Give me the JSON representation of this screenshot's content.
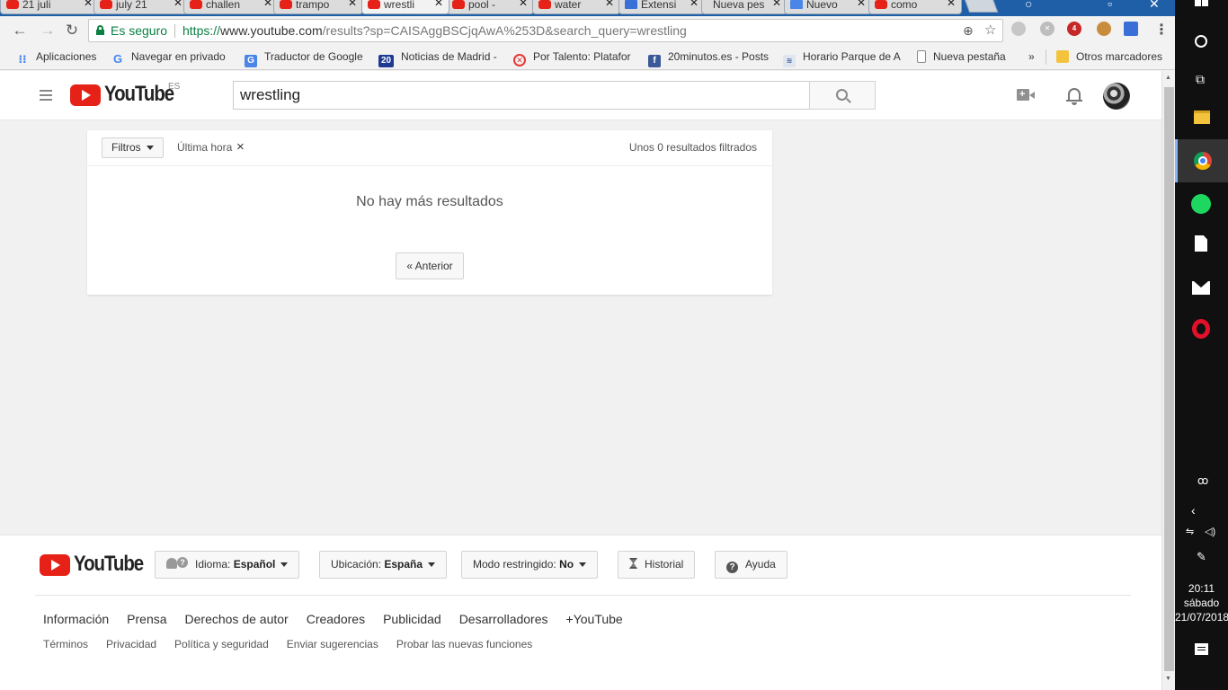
{
  "browser": {
    "tabs": [
      {
        "label": "21 juli",
        "favicon": "youtube-icon",
        "active": false
      },
      {
        "label": "july 21",
        "favicon": "youtube-icon",
        "active": false
      },
      {
        "label": "challen",
        "favicon": "youtube-icon",
        "active": false
      },
      {
        "label": "trampo",
        "favicon": "youtube-icon",
        "active": false
      },
      {
        "label": "wrestli",
        "favicon": "youtube-icon",
        "active": true
      },
      {
        "label": "pool -",
        "favicon": "youtube-icon",
        "active": false
      },
      {
        "label": "water",
        "favicon": "youtube-icon",
        "active": false
      },
      {
        "label": "Extensi",
        "favicon": "puzzle-icon",
        "active": false
      },
      {
        "label": "Nueva pes",
        "favicon": "page-icon",
        "active": false
      },
      {
        "label": "Nuevo",
        "favicon": "doc-icon",
        "active": false
      },
      {
        "label": "como",
        "favicon": "youtube-icon",
        "active": false
      }
    ],
    "secure_label": "Es seguro",
    "url_scheme": "https://",
    "url_host": "www.youtube.com",
    "url_rest": "/results?sp=CAISAggBSCjqAwA%253D&search_query=wrestling",
    "bookmarks": [
      {
        "label": "Aplicaciones",
        "icon": "apps-grid-icon",
        "color": "#4285f4"
      },
      {
        "label": "Navegar en privado",
        "icon": "google-g-icon",
        "color": "#4285f4"
      },
      {
        "label": "Traductor de Google",
        "icon": "translate-icon",
        "color": "#4a86e8"
      },
      {
        "label": "Noticias de Madrid -",
        "icon": "20minutos-icon",
        "color": "#1f3a93"
      },
      {
        "label": "Por Talento: Platafor",
        "icon": "talento-icon",
        "color": "#e53935"
      },
      {
        "label": "20minutos.es - Posts",
        "icon": "facebook-icon",
        "color": "#3b5998"
      },
      {
        "label": "Horario Parque de A",
        "icon": "parque-icon",
        "color": "#7a9cc6"
      },
      {
        "label": "Nueva pestaña",
        "icon": "page-icon",
        "color": "#ffffff"
      },
      {
        "label": "Otros marcadores",
        "icon": "folder-icon",
        "color": "#f4c33d"
      }
    ],
    "bookmarks_overflow": "»",
    "extension_badge": "4"
  },
  "masthead": {
    "logo_text": "YouTube",
    "region": "ES",
    "search_value": "wrestling"
  },
  "results": {
    "filters_label": "Filtros",
    "active_filter": "Última hora",
    "remove_filter": "×",
    "count_label": "Unos 0 resultados filtrados",
    "no_more": "No hay más resultados",
    "prev_label": "« Anterior"
  },
  "footer": {
    "logo_text": "YouTube",
    "language_prefix": "Idioma:",
    "language_value": "Español",
    "location_prefix": "Ubicación:",
    "location_value": "España",
    "restricted_prefix": "Modo restringido:",
    "restricted_value": "No",
    "history_label": "Historial",
    "help_label": "Ayuda",
    "primary_links": [
      "Información",
      "Prensa",
      "Derechos de autor",
      "Creadores",
      "Publicidad",
      "Desarrolladores",
      "+YouTube"
    ],
    "secondary_links": [
      "Términos",
      "Privacidad",
      "Política y seguridad",
      "Enviar sugerencias",
      "Probar las nuevas funciones"
    ]
  },
  "taskbar": {
    "time": "20:11",
    "day": "sábado",
    "date": "21/07/2018"
  },
  "colors": {
    "youtube_red": "#e62117",
    "secure_green": "#0b8043",
    "chrome_frame": "#1f5fa7"
  }
}
